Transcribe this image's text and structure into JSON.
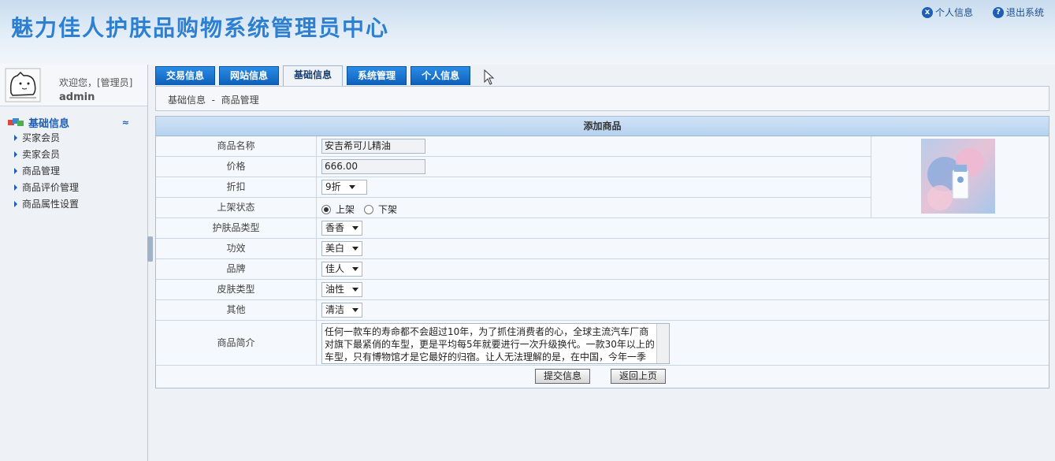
{
  "header": {
    "title": "魅力佳人护肤品购物系统管理员中心",
    "links": [
      {
        "icon": "user-info-icon",
        "label": "个人信息"
      },
      {
        "icon": "help-icon",
        "label": "退出系统"
      }
    ]
  },
  "sidebar": {
    "welcome": "欢迎您，[管理员]",
    "username": "admin",
    "group_title": "基础信息",
    "collapse_symbol": "≈",
    "items": [
      {
        "label": "买家会员"
      },
      {
        "label": "卖家会员"
      },
      {
        "label": "商品管理"
      },
      {
        "label": "商品评价管理"
      },
      {
        "label": "商品属性设置"
      }
    ]
  },
  "tabs": [
    {
      "label": "交易信息",
      "active": false
    },
    {
      "label": "网站信息",
      "active": false
    },
    {
      "label": "基础信息",
      "active": true
    },
    {
      "label": "系统管理",
      "active": false
    },
    {
      "label": "个人信息",
      "active": false
    }
  ],
  "breadcrumb": "基础信息  -  商品管理",
  "form": {
    "title": "添加商品",
    "fields": {
      "name": {
        "label": "商品名称",
        "value": "安吉希可儿精油"
      },
      "price": {
        "label": "价格",
        "value": "666.00"
      },
      "discount": {
        "label": "折扣",
        "value": "9折"
      },
      "status": {
        "label": "上架状态",
        "option_on": "上架",
        "option_off": "下架",
        "selected": "上架"
      },
      "category": {
        "label": "护肤品类型",
        "value": "香香"
      },
      "effect": {
        "label": "功效",
        "value": "美白"
      },
      "brand": {
        "label": "品牌",
        "value": "佳人"
      },
      "skin": {
        "label": "皮肤类型",
        "value": "油性"
      },
      "other": {
        "label": "其他",
        "value": "清洁"
      },
      "desc": {
        "label": "商品简介",
        "value": "任何一款车的寿命都不会超过10年，为了抓住消费者的心，全球主流汽车厂商对旗下最紧俏的车型，更是平均每5年就要进行一次升级换代。一款30年以上的车型，只有博物馆才是它最好的归宿。让人无法理解的是，在中国，今年一季"
      }
    },
    "buttons": {
      "submit": "提交信息",
      "back": "返回上页"
    }
  }
}
